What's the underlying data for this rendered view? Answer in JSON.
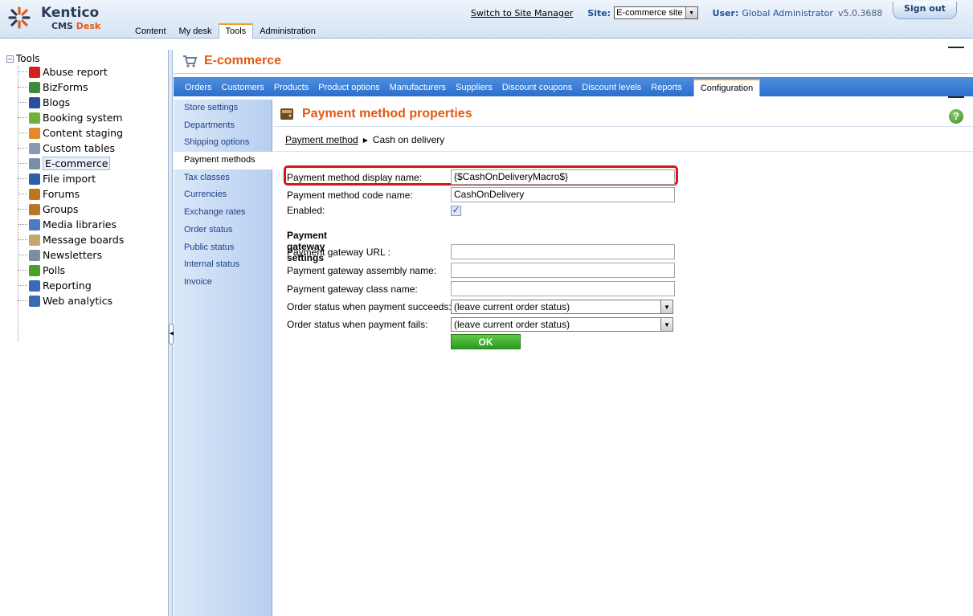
{
  "header": {
    "brand_name": "Kentico",
    "brand_product": "CMS",
    "brand_desk": "Desk",
    "switch_link": "Switch to Site Manager",
    "site_label": "Site:",
    "site_value": "E-commerce site",
    "user_label": "User:",
    "user_value": "Global Administrator",
    "version": "v5.0.3688",
    "sign_out": "Sign out",
    "nav": [
      "Content",
      "My desk",
      "Tools",
      "Administration"
    ],
    "active_nav": "Tools"
  },
  "tree": {
    "root": "Tools",
    "items": [
      {
        "label": "Abuse report",
        "icon": "abuse-report-icon",
        "color": "#d62020"
      },
      {
        "label": "BizForms",
        "icon": "bizforms-icon",
        "color": "#3d8a3a"
      },
      {
        "label": "Blogs",
        "icon": "blogs-icon",
        "color": "#2a4f9a"
      },
      {
        "label": "Booking system",
        "icon": "booking-icon",
        "color": "#6bb33a"
      },
      {
        "label": "Content staging",
        "icon": "staging-icon",
        "color": "#e08a2a"
      },
      {
        "label": "Custom tables",
        "icon": "custom-tables-icon",
        "color": "#8a9bb0"
      },
      {
        "label": "E-commerce",
        "icon": "ecommerce-icon",
        "color": "#7a8da8"
      },
      {
        "label": "File import",
        "icon": "file-import-icon",
        "color": "#2f5ea8"
      },
      {
        "label": "Forums",
        "icon": "forums-icon",
        "color": "#c0761d"
      },
      {
        "label": "Groups",
        "icon": "groups-icon",
        "color": "#b8762a"
      },
      {
        "label": "Media libraries",
        "icon": "media-icon",
        "color": "#4a7cbf"
      },
      {
        "label": "Message boards",
        "icon": "message-boards-icon",
        "color": "#c2a86a"
      },
      {
        "label": "Newsletters",
        "icon": "newsletters-icon",
        "color": "#7b8ea3"
      },
      {
        "label": "Polls",
        "icon": "polls-icon",
        "color": "#4aa02a"
      },
      {
        "label": "Reporting",
        "icon": "reporting-icon",
        "color": "#3a6bb5"
      },
      {
        "label": "Web analytics",
        "icon": "web-analytics-icon",
        "color": "#3a6bb5"
      }
    ],
    "selected": "E-commerce"
  },
  "module": {
    "title": "E-commerce",
    "tabs": [
      "Orders",
      "Customers",
      "Products",
      "Product options",
      "Manufacturers",
      "Suppliers",
      "Discount coupons",
      "Discount levels",
      "Reports",
      "Configuration"
    ],
    "active_tab": "Configuration"
  },
  "config_menu": {
    "items": [
      "Store settings",
      "Departments",
      "Shipping options",
      "Payment methods",
      "Tax classes",
      "Currencies",
      "Exchange rates",
      "Order status",
      "Public status",
      "Internal status",
      "Invoice"
    ],
    "active": "Payment methods"
  },
  "content": {
    "title": "Payment method properties",
    "breadcrumb_link": "Payment method",
    "breadcrumb_current": "Cash on delivery",
    "fields": {
      "display_name_label": "Payment method display name:",
      "display_name_value": "{$CashOnDeliveryMacro$}",
      "code_name_label": "Payment method code name:",
      "code_name_value": "CashOnDelivery",
      "enabled_label": "Enabled:",
      "enabled_checked": true,
      "gateway_heading": "Payment gateway settings",
      "gateway_url_label": "Payment gateway URL :",
      "gateway_url_value": "",
      "gateway_assembly_label": "Payment gateway assembly name:",
      "gateway_assembly_value": "",
      "gateway_class_label": "Payment gateway class name:",
      "gateway_class_value": "",
      "succeeds_label": "Order status when payment succeeds:",
      "succeeds_value": "(leave current order status)",
      "fails_label": "Order status when payment fails:",
      "fails_value": "(leave current order status)",
      "ok_button": "OK"
    },
    "highlight_color": "#d6141c"
  }
}
